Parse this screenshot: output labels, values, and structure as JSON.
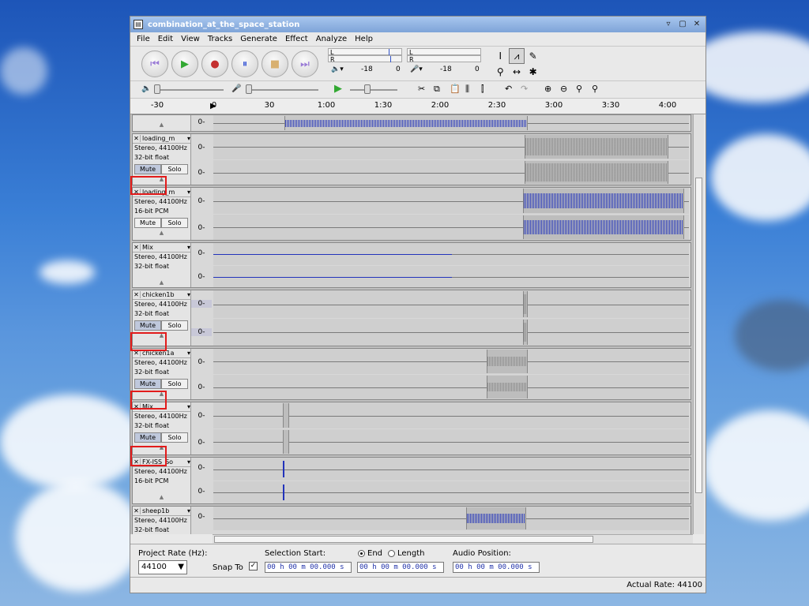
{
  "window": {
    "title": "combination_at_the_space_station"
  },
  "menu": [
    "File",
    "Edit",
    "View",
    "Tracks",
    "Generate",
    "Effect",
    "Analyze",
    "Help"
  ],
  "transport": {
    "buttons": [
      {
        "name": "skip-start",
        "glyph": "⏮",
        "color": "#9a7bd6"
      },
      {
        "name": "play",
        "glyph": "▶",
        "color": "#32a832"
      },
      {
        "name": "record",
        "glyph": "●",
        "color": "#c43030"
      },
      {
        "name": "pause",
        "glyph": "⏸",
        "color": "#3d5bd6"
      },
      {
        "name": "stop",
        "glyph": "■",
        "color": "#d8b070"
      },
      {
        "name": "skip-end",
        "glyph": "⏭",
        "color": "#9a7bd6"
      }
    ]
  },
  "meters": {
    "play_L": "L",
    "play_R": "R",
    "rec_L": "L",
    "rec_R": "R",
    "play_db": "-18",
    "play_zero": "0",
    "rec_db": "-18",
    "rec_zero": "0"
  },
  "ruler": [
    "-30",
    "0",
    "30",
    "1:00",
    "1:30",
    "2:00",
    "2:30",
    "3:00",
    "3:30",
    "4:00"
  ],
  "tracks": [
    {
      "name": "",
      "line1": "",
      "line2": "",
      "mute": "",
      "solo": "",
      "partial": true
    },
    {
      "name": "loading_m",
      "line1": "Stereo, 44100Hz",
      "line2": "32-bit float",
      "mute": "Mute",
      "solo": "Solo",
      "mute_on": true
    },
    {
      "name": "loading_m",
      "line1": "Stereo, 44100Hz",
      "line2": "16-bit PCM",
      "mute": "Mute",
      "solo": "Solo",
      "mute_on": false
    },
    {
      "name": "Mix",
      "line1": "Stereo, 44100Hz",
      "line2": "32-bit float",
      "mute": "",
      "solo": "",
      "mute_on": false
    },
    {
      "name": "chicken1b",
      "line1": "Stereo, 44100Hz",
      "line2": "32-bit float",
      "mute": "Mute",
      "solo": "Solo",
      "mute_on": true
    },
    {
      "name": "chicken1a",
      "line1": "Stereo, 44100Hz",
      "line2": "32-bit float",
      "mute": "Mute",
      "solo": "Solo",
      "mute_on": true
    },
    {
      "name": "Mix",
      "line1": "Stereo, 44100Hz",
      "line2": "32-bit float",
      "mute": "Mute",
      "solo": "Solo",
      "mute_on": true
    },
    {
      "name": "FX-ISS_So",
      "line1": "Stereo, 44100Hz",
      "line2": "16-bit PCM",
      "mute": "",
      "solo": "",
      "mute_on": false
    },
    {
      "name": "sheep1b",
      "line1": "Stereo, 44100Hz",
      "line2": "32-bit float",
      "mute": "",
      "solo": "",
      "mute_on": false
    }
  ],
  "track_zero": "0-",
  "selection": {
    "project_rate_label": "Project Rate (Hz):",
    "project_rate": "44100",
    "snap_label": "Snap To",
    "selection_start_label": "Selection Start:",
    "end_label": "End",
    "length_label": "Length",
    "audio_position_label": "Audio Position:",
    "start_value": "00 h 00 m 00.000 s",
    "end_value": "00 h 00 m 00.000 s",
    "position_value": "00 h 00 m 00.000 s"
  },
  "status": {
    "actual_rate": "Actual Rate: 44100"
  }
}
